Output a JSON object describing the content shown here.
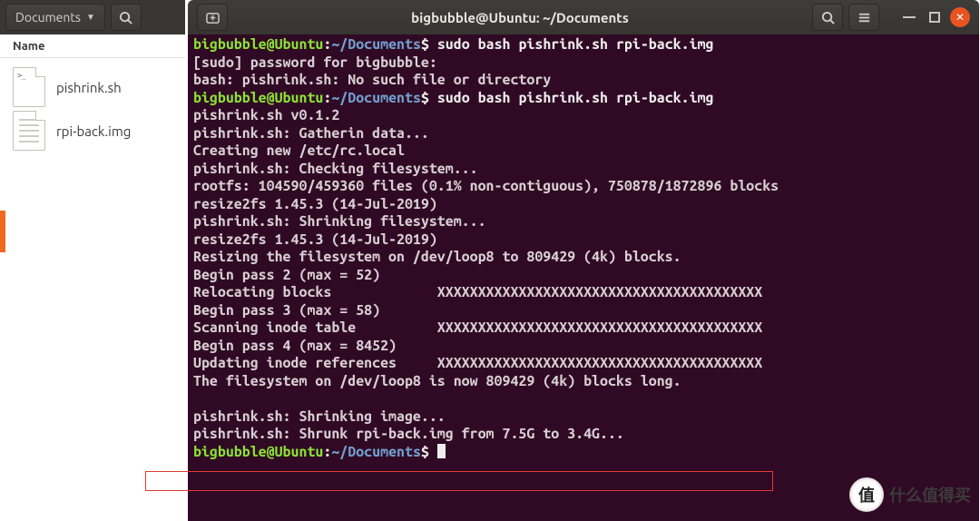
{
  "filemanager": {
    "breadcrumb": "Documents",
    "columns": {
      "name": "Name"
    },
    "items": [
      {
        "name": "pishrink.sh",
        "icon": "sh"
      },
      {
        "name": "rpi-back.img",
        "icon": "txt"
      }
    ]
  },
  "terminal": {
    "title": "bigbubble@Ubuntu: ~/Documents",
    "prompt": {
      "userhost": "bigbubble@Ubuntu",
      "colon": ":",
      "path": "~/Documents",
      "symbol": "$"
    },
    "commands": [
      "sudo bash pishrink.sh rpi-back.img",
      "sudo bash pishrink.sh rpi-back.img"
    ],
    "lines": {
      "l1": "[sudo] password for bigbubble:",
      "l2": "bash: pishrink.sh: No such file or directory",
      "l3": "pishrink.sh v0.1.2",
      "l4": "pishrink.sh: Gatherin data...",
      "l5": "Creating new /etc/rc.local",
      "l6": "pishrink.sh: Checking filesystem...",
      "l7": "rootfs: 104590/459360 files (0.1% non-contiguous), 750878/1872896 blocks",
      "l8": "resize2fs 1.45.3 (14-Jul-2019)",
      "l9": "pishrink.sh: Shrinking filesystem...",
      "l10": "resize2fs 1.45.3 (14-Jul-2019)",
      "l11": "Resizing the filesystem on /dev/loop8 to 809429 (4k) blocks.",
      "l12": "Begin pass 2 (max = 52)",
      "l13": "Relocating blocks             XXXXXXXXXXXXXXXXXXXXXXXXXXXXXXXXXXXXXXXX",
      "l14": "Begin pass 3 (max = 58)",
      "l15": "Scanning inode table          XXXXXXXXXXXXXXXXXXXXXXXXXXXXXXXXXXXXXXXX",
      "l16": "Begin pass 4 (max = 8452)",
      "l17": "Updating inode references     XXXXXXXXXXXXXXXXXXXXXXXXXXXXXXXXXXXXXXXX",
      "l18": "The filesystem on /dev/loop8 is now 809429 (4k) blocks long.",
      "blank": "",
      "l19": "pishrink.sh: Shrinking image...",
      "l20": "pishrink.sh: Shrunk rpi-back.img from 7.5G to 3.4G..."
    }
  },
  "overlay": {
    "badge": "值",
    "brand": "什么值得买"
  }
}
